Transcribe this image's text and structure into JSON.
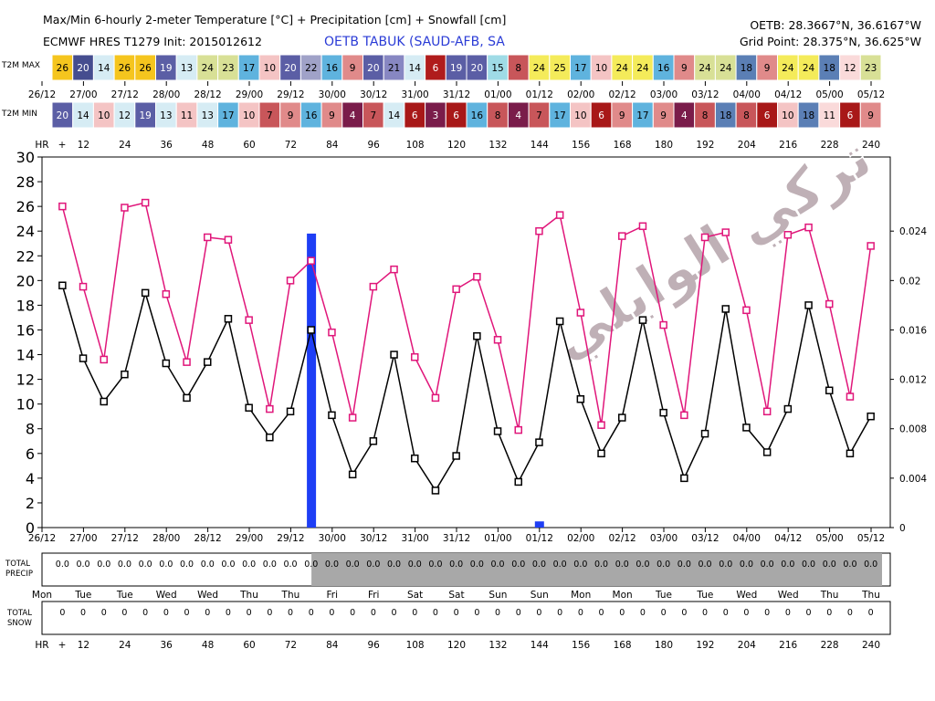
{
  "header": {
    "title_line1": "Max/Min 6-hourly 2-meter Temperature [°C] + Precipitation [cm] + Snowfall [cm]",
    "title_line2": "ECMWF HRES T1279 Init: 2015012612",
    "station": "OETB TABUK (SAUD-AFB, SA",
    "coords": "OETB: 28.3667°N, 36.6167°W",
    "gridpoint": "Grid Point: 28.375°N, 36.625°W"
  },
  "watermark": "تركي الوايلي",
  "strips": {
    "max_label": "T2M MAX",
    "min_label": "T2M MIN",
    "hr_label": "HR",
    "hr_first": "+",
    "max_values": [
      26,
      20,
      14,
      26,
      26,
      19,
      13,
      24,
      23,
      17,
      10,
      20,
      22,
      16,
      9,
      20,
      21,
      14,
      6,
      19,
      20,
      15,
      8,
      24,
      25,
      17,
      10,
      24,
      24,
      16,
      9,
      24,
      24,
      18,
      9,
      24,
      24,
      18,
      12,
      23
    ],
    "min_values": [
      20,
      14,
      10,
      12,
      19,
      13,
      11,
      13,
      17,
      10,
      7,
      9,
      16,
      9,
      4,
      7,
      14,
      6,
      3,
      6,
      16,
      8,
      4,
      7,
      17,
      10,
      6,
      9,
      17,
      9,
      4,
      8,
      18,
      8,
      6,
      10,
      18,
      11,
      6,
      9
    ],
    "max_colors": [
      "#f5c51e",
      "#454d8f",
      "#d6ecf4",
      "#f5c51e",
      "#f5c51e",
      "#5b5ea5",
      "#d6ecf4",
      "#d8e096",
      "#d8e096",
      "#5fb3de",
      "#f4c4c4",
      "#5b5ea5",
      "#a0a2c8",
      "#5fb3de",
      "#e08a8a",
      "#5b5ea5",
      "#8787c2",
      "#d6ecf4",
      "#b01c1c",
      "#5b5ea5",
      "#5b5ea5",
      "#9fdbe6",
      "#c8565a",
      "#f4eb5a",
      "#f4eb5a",
      "#5fb3de",
      "#f4c4c4",
      "#f4eb5a",
      "#f4eb5a",
      "#5fb3de",
      "#e08a8a",
      "#d8e096",
      "#d8e096",
      "#5b7fb5",
      "#e08a8a",
      "#f4eb5a",
      "#f4eb5a",
      "#5b7fb5",
      "#fadada",
      "#d8e096"
    ],
    "min_colors": [
      "#5b5ea5",
      "#d6ecf4",
      "#f4c4c4",
      "#d6ecf4",
      "#5b5ea5",
      "#d6ecf4",
      "#f4c4c4",
      "#d6ecf4",
      "#5fb3de",
      "#f4c4c4",
      "#c8565a",
      "#e08a8a",
      "#5fb3de",
      "#e08a8a",
      "#7a1c4a",
      "#c8565a",
      "#d6ecf4",
      "#a81818",
      "#7a1c4a",
      "#a81818",
      "#5fb3de",
      "#c8565a",
      "#7a1c4a",
      "#c8565a",
      "#5fb3de",
      "#f4c4c4",
      "#a81818",
      "#e08a8a",
      "#5fb3de",
      "#e08a8a",
      "#7a1c4a",
      "#c8565a",
      "#5b7fb5",
      "#c8565a",
      "#a81818",
      "#f4c4c4",
      "#5b7fb5",
      "#fadada",
      "#a81818",
      "#e08a8a"
    ],
    "date_labels": [
      "26/12",
      "27/00",
      "27/12",
      "28/00",
      "28/12",
      "29/00",
      "29/12",
      "30/00",
      "30/12",
      "31/00",
      "31/12",
      "01/00",
      "01/12",
      "02/00",
      "02/12",
      "03/00",
      "03/12",
      "04/00",
      "04/12",
      "05/00",
      "05/12"
    ],
    "hr_labels": [
      "12",
      "24",
      "36",
      "48",
      "60",
      "72",
      "84",
      "96",
      "108",
      "120",
      "132",
      "144",
      "156",
      "168",
      "180",
      "192",
      "204",
      "216",
      "228",
      "240"
    ]
  },
  "colors": {
    "max_line": "#e0167a",
    "min_line": "#000000",
    "precip_bar": "#1e3ef5",
    "precip_shade": "#a8a8a8"
  },
  "chart_data": {
    "type": "line",
    "x_hours": [
      0,
      6,
      12,
      18,
      24,
      30,
      36,
      42,
      48,
      54,
      60,
      66,
      72,
      78,
      84,
      90,
      96,
      102,
      108,
      114,
      120,
      126,
      132,
      138,
      144,
      150,
      156,
      162,
      168,
      174,
      180,
      186,
      192,
      198,
      204,
      210,
      216,
      222,
      228,
      234
    ],
    "series": [
      {
        "values": [
          26.0,
          19.5,
          13.6,
          25.9,
          26.3,
          18.9,
          13.4,
          23.5,
          23.3,
          16.8,
          9.6,
          20.0,
          21.6,
          15.8,
          8.9,
          19.5,
          20.9,
          13.8,
          10.5,
          19.3,
          20.3,
          15.2,
          7.9,
          24.0,
          25.3,
          17.4,
          8.3,
          23.6,
          24.4,
          16.4,
          9.1,
          23.5,
          23.9,
          17.6,
          9.4,
          23.7,
          24.3,
          18.1,
          10.6,
          22.8
        ]
      },
      {
        "values": [
          19.6,
          13.7,
          10.2,
          12.4,
          19.0,
          13.3,
          10.5,
          13.4,
          16.9,
          9.7,
          7.3,
          9.4,
          16.0,
          9.1,
          4.3,
          7.0,
          14.0,
          5.6,
          3.0,
          5.8,
          15.5,
          7.8,
          3.7,
          6.9,
          16.7,
          10.4,
          6.0,
          8.9,
          16.8,
          9.3,
          4.0,
          7.6,
          17.7,
          8.1,
          6.1,
          9.6,
          18.0,
          11.1,
          6.0,
          9.0
        ]
      }
    ],
    "precip_bars": [
      {
        "hour": 78,
        "value": 0.0238
      },
      {
        "hour": 144,
        "value": 0.0005
      }
    ],
    "y_left_range": [
      0,
      30
    ],
    "y_left_ticks": [
      "0",
      "2",
      "4",
      "6",
      "8",
      "10",
      "12",
      "14",
      "16",
      "18",
      "20",
      "22",
      "24",
      "26",
      "28",
      "30"
    ],
    "y_right_range": [
      0,
      0.03
    ],
    "y_right_ticks": [
      "0",
      "0.004",
      "0.008",
      "0.012",
      "0.016",
      "0.02",
      "0.024"
    ],
    "x_date_labels": [
      "26/12",
      "27/00",
      "27/12",
      "28/00",
      "28/12",
      "29/00",
      "29/12",
      "30/00",
      "30/12",
      "31/00",
      "31/12",
      "01/00",
      "01/12",
      "02/00",
      "02/12",
      "03/00",
      "03/12",
      "04/00",
      "04/12",
      "05/00",
      "05/12"
    ]
  },
  "precip_panel": {
    "label_line1": "TOTAL",
    "label_line2": "PRECIP",
    "values": [
      "0.0",
      "0.0",
      "0.0",
      "0.0",
      "0.0",
      "0.0",
      "0.0",
      "0.0",
      "0.0",
      "0.0",
      "0.0",
      "0.0",
      "0.0",
      "0.0",
      "0.0",
      "0.0",
      "0.0",
      "0.0",
      "0.0",
      "0.0",
      "0.0",
      "0.0",
      "0.0",
      "0.0",
      "0.0",
      "0.0",
      "0.0",
      "0.0",
      "0.0",
      "0.0",
      "0.0",
      "0.0",
      "0.0",
      "0.0",
      "0.0",
      "0.0",
      "0.0",
      "0.0",
      "0.0",
      "0.0"
    ],
    "shade_from_hour": 78
  },
  "day_labels": [
    "Mon",
    "Tue",
    "Tue",
    "Wed",
    "Wed",
    "Thu",
    "Thu",
    "Fri",
    "Fri",
    "Sat",
    "Sat",
    "Sun",
    "Sun",
    "Mon",
    "Mon",
    "Tue",
    "Tue",
    "Wed",
    "Wed",
    "Thu",
    "Thu"
  ],
  "snow_panel": {
    "label_line1": "TOTAL",
    "label_line2": "SNOW",
    "values": [
      "0",
      "0",
      "0",
      "0",
      "0",
      "0",
      "0",
      "0",
      "0",
      "0",
      "0",
      "0",
      "0",
      "0",
      "0",
      "0",
      "0",
      "0",
      "0",
      "0",
      "0",
      "0",
      "0",
      "0",
      "0",
      "0",
      "0",
      "0",
      "0",
      "0",
      "0",
      "0",
      "0",
      "0",
      "0",
      "0",
      "0",
      "0",
      "0",
      "0"
    ]
  },
  "bottom_hr": {
    "label": "HR",
    "first": "+",
    "labels": [
      "12",
      "24",
      "36",
      "48",
      "60",
      "72",
      "84",
      "96",
      "108",
      "120",
      "132",
      "144",
      "156",
      "168",
      "180",
      "192",
      "204",
      "216",
      "228",
      "240"
    ]
  }
}
